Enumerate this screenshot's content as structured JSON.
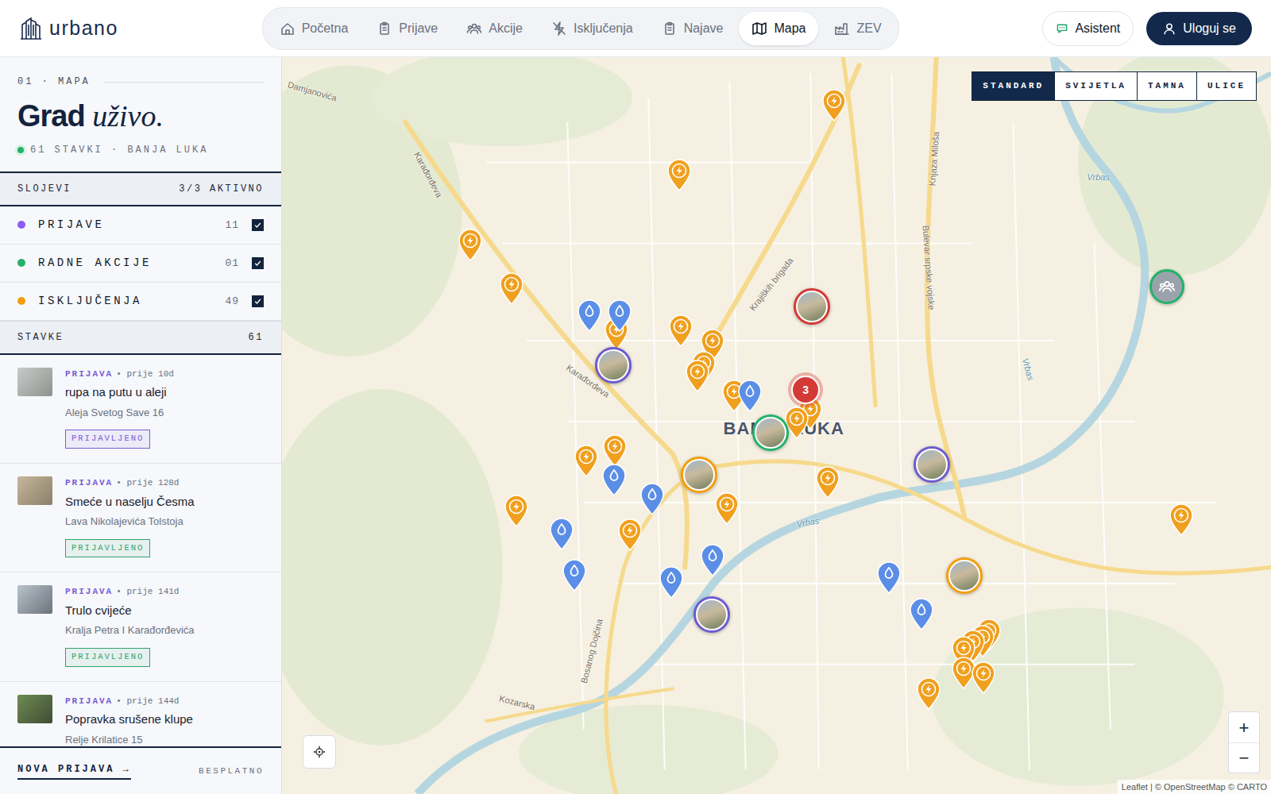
{
  "brand": {
    "name": "urbano"
  },
  "nav": [
    {
      "label": "Početna",
      "selected": false
    },
    {
      "label": "Prijave",
      "selected": false
    },
    {
      "label": "Akcije",
      "selected": false
    },
    {
      "label": "Isključenja",
      "selected": false
    },
    {
      "label": "Najave",
      "selected": false
    },
    {
      "label": "Mapa",
      "selected": true
    },
    {
      "label": "ZEV",
      "selected": false
    }
  ],
  "actions": {
    "assistant": "Asistent",
    "login": "Uloguj se"
  },
  "sidebar": {
    "eyebrow": "01 · MAPA",
    "title": "Grad",
    "title_accent": "uživo.",
    "summary": "61 STAVKI · BANJA LUKA",
    "layers_title": "SLOJEVI",
    "layers_status": "3/3 AKTIVNO",
    "layers": [
      {
        "label": "PRIJAVE",
        "count": "11",
        "checked": true,
        "color": "#8b5cf6"
      },
      {
        "label": "RADNE AKCIJE",
        "count": "01",
        "checked": true,
        "color": "#22b26b"
      },
      {
        "label": "ISKLJUČENJA",
        "count": "49",
        "checked": true,
        "color": "#f59e0b"
      }
    ],
    "items_title": "STAVKE",
    "items_count": "61",
    "items": [
      {
        "type": "PRIJAVA",
        "time": "• prije 10d",
        "title": "rupa na putu u aleji",
        "address": "Aleja Svetog Save 16",
        "status": "PRIJAVLJENO",
        "color": "#7c5cd6"
      },
      {
        "type": "PRIJAVA",
        "time": "• prije 128d",
        "title": "Smeće u naselju Česma",
        "address": "Lava Nikolajevića Tolstoja",
        "status": "PRIJAVLJENO",
        "color": "#2fa36b"
      },
      {
        "type": "PRIJAVA",
        "time": "• prije 141d",
        "title": "Trulo cvijeće",
        "address": "Kralja Petra I Karađorđevića",
        "status": "PRIJAVLJENO",
        "color": "#2fa36b"
      },
      {
        "type": "PRIJAVA",
        "time": "• prije 144d",
        "title": "Popravka srušene klupe",
        "address": "Relje Krilatice 15"
      }
    ],
    "footer": {
      "cta": "NOVA PRIJAVA →",
      "note": "BESPLATNO"
    }
  },
  "map": {
    "styles": [
      {
        "label": "STANDARD",
        "selected": true
      },
      {
        "label": "SVIJETLA",
        "selected": false
      },
      {
        "label": "TAMNA",
        "selected": false
      },
      {
        "label": "ULICE",
        "selected": false
      }
    ],
    "labels": [
      "Damjanovića",
      "Karađorđeva",
      "Karađorđeva",
      "Krajiških brigada",
      "Bulevar srpske vojske",
      "Knjaza Miloša",
      "Vrbas",
      "Vrbas",
      "Vrbas",
      "BANJA LUKA",
      "Bosanog Dojčina",
      "Kozarska"
    ],
    "markers": [
      {
        "kind": "outage"
      },
      {
        "kind": "outage"
      },
      {
        "kind": "outage"
      },
      {
        "kind": "outage"
      },
      {
        "kind": "outage"
      },
      {
        "kind": "outage"
      },
      {
        "kind": "outage"
      },
      {
        "kind": "outage"
      },
      {
        "kind": "outage"
      },
      {
        "kind": "outage"
      },
      {
        "kind": "outage"
      },
      {
        "kind": "outage"
      },
      {
        "kind": "outage"
      },
      {
        "kind": "outage"
      },
      {
        "kind": "outage"
      },
      {
        "kind": "outage"
      },
      {
        "kind": "outage"
      },
      {
        "kind": "outage"
      },
      {
        "kind": "outage"
      },
      {
        "kind": "outage"
      },
      {
        "kind": "outage"
      },
      {
        "kind": "outage"
      },
      {
        "kind": "outage"
      },
      {
        "kind": "outage"
      },
      {
        "kind": "outage"
      },
      {
        "kind": "outage"
      },
      {
        "kind": "water"
      },
      {
        "kind": "water"
      },
      {
        "kind": "water"
      },
      {
        "kind": "water"
      },
      {
        "kind": "water"
      },
      {
        "kind": "water"
      },
      {
        "kind": "water"
      },
      {
        "kind": "water"
      },
      {
        "kind": "water"
      },
      {
        "kind": "water"
      },
      {
        "kind": "water"
      },
      {
        "kind": "photo",
        "color": "#6d5bd0"
      },
      {
        "kind": "photo",
        "color": "#d43a34"
      },
      {
        "kind": "photo",
        "color": "#22b26b"
      },
      {
        "kind": "photo",
        "color": "#f59e0b"
      },
      {
        "kind": "photo",
        "color": "#6d5bd0"
      },
      {
        "kind": "photo",
        "color": "#f59e0b"
      },
      {
        "kind": "photo",
        "color": "#6d5bd0"
      },
      {
        "kind": "cluster",
        "label": "3"
      },
      {
        "kind": "action"
      }
    ],
    "zoom_in": "+",
    "zoom_out": "−",
    "attribution": "Leaflet | © OpenStreetMap © CARTO"
  }
}
